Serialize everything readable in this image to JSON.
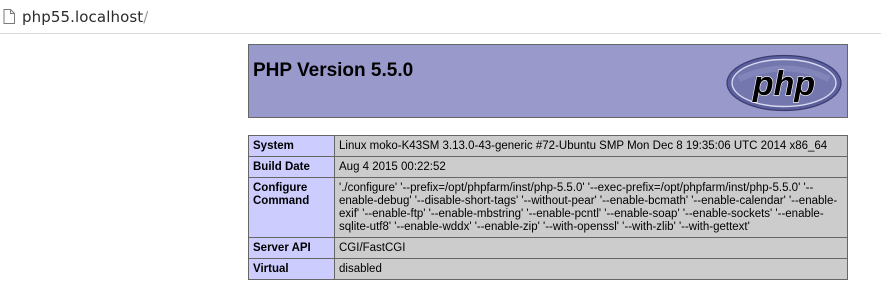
{
  "urlbar": {
    "icon": "page-icon",
    "host": "php55.localhost",
    "path": "/"
  },
  "header": {
    "title": "PHP Version 5.5.0",
    "logo_text": "php"
  },
  "info_rows": [
    {
      "key": "System",
      "value": "Linux moko-K43SM 3.13.0-43-generic #72-Ubuntu SMP Mon Dec 8 19:35:06 UTC 2014 x86_64"
    },
    {
      "key": "Build Date",
      "value": "Aug 4 2015 00:22:52"
    },
    {
      "key": "Configure Command",
      "value": "'./configure' '--prefix=/opt/phpfarm/inst/php-5.5.0' '--exec-prefix=/opt/phpfarm/inst/php-5.5.0' '--enable-debug' '--disable-short-tags' '--without-pear' '--enable-bcmath' '--enable-calendar' '--enable-exif' '--enable-ftp' '--enable-mbstring' '--enable-pcntl' '--enable-soap' '--enable-sockets' '--enable-sqlite-utf8' '--enable-wddx' '--enable-zip' '--with-openssl' '--with-zlib' '--with-gettext'"
    },
    {
      "key": "Server API",
      "value": "CGI/FastCGI"
    },
    {
      "key": "Virtual",
      "value": "disabled"
    }
  ],
  "colors": {
    "header_bg": "#9999cc",
    "key_cell_bg": "#ccccff",
    "value_cell_bg": "#cccccc",
    "border": "#666666"
  }
}
